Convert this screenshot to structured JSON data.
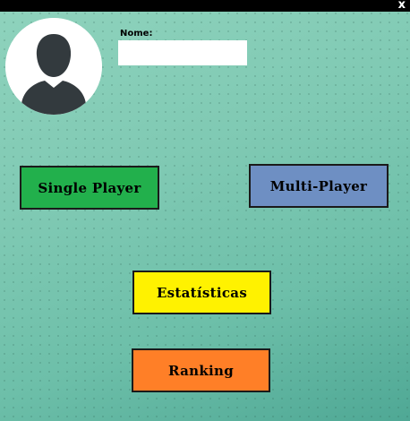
{
  "window": {
    "close_glyph": "x"
  },
  "profile": {
    "avatar_icon": "user-silhouette-icon"
  },
  "name_field": {
    "label": "Nome:",
    "value": "",
    "placeholder": ""
  },
  "menu": {
    "single_player": "Single Player",
    "multi_player": "Multi-Player",
    "statistics": "Estatísticas",
    "ranking": "Ranking"
  },
  "colors": {
    "single_player": "#22b04c",
    "multi_player": "#6e8fc3",
    "statistics": "#fff200",
    "ranking": "#ff7f27",
    "titlebar": "#000000"
  }
}
